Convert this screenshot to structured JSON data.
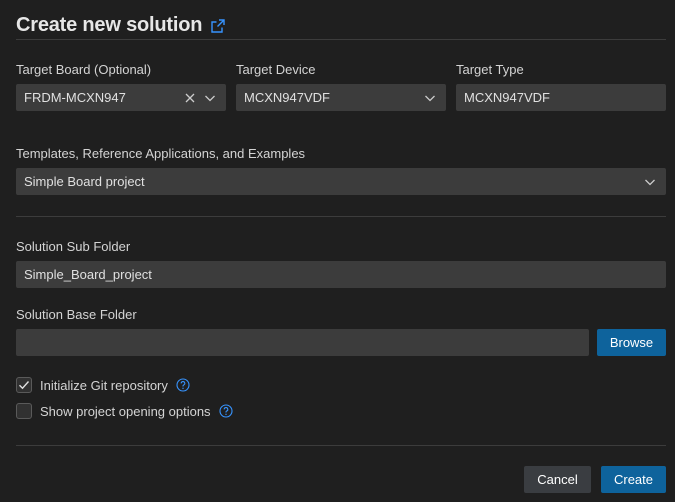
{
  "title": "Create new solution",
  "target_board": {
    "label": "Target Board (Optional)",
    "value": "FRDM-MCXN947"
  },
  "target_device": {
    "label": "Target Device",
    "value": "MCXN947VDF"
  },
  "target_type": {
    "label": "Target Type",
    "value": "MCXN947VDF"
  },
  "templates": {
    "label": "Templates, Reference Applications, and Examples",
    "value": "Simple Board project"
  },
  "sub_folder": {
    "label": "Solution Sub Folder",
    "value": "Simple_Board_project"
  },
  "base_folder": {
    "label": "Solution Base Folder",
    "value": "",
    "browse_label": "Browse"
  },
  "options": {
    "init_git": {
      "label": "Initialize Git repository",
      "checked": true
    },
    "show_opening": {
      "label": "Show project opening options",
      "checked": false
    }
  },
  "footer": {
    "cancel_label": "Cancel",
    "create_label": "Create"
  },
  "colors": {
    "background": "#1f1f1f",
    "input": "#3c3c3c",
    "accent": "#0e639c",
    "link": "#3794ff"
  },
  "icons": {
    "title": "external-link-icon",
    "clear": "close-icon",
    "dropdown": "chevron-down-icon",
    "check": "checkmark-icon",
    "help": "help-circle-icon"
  }
}
